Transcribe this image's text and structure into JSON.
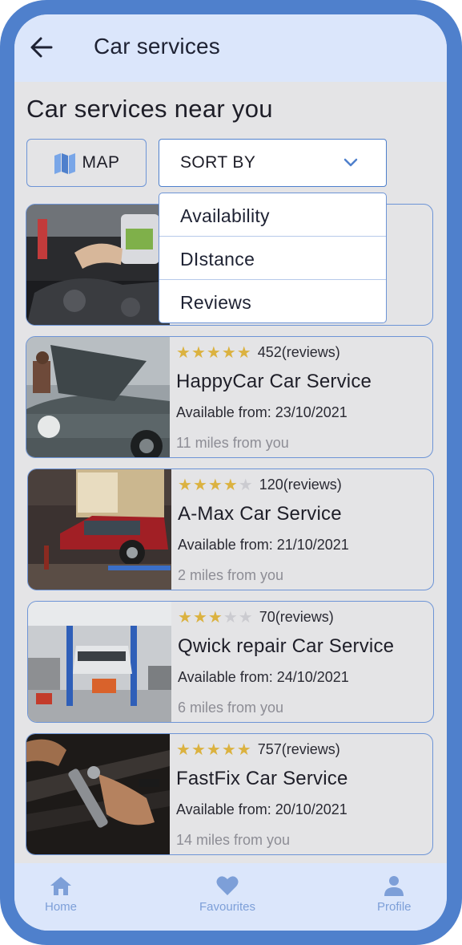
{
  "header": {
    "title": "Car services",
    "back_icon": "arrow-left-icon"
  },
  "section_title": "Car services near you",
  "controls": {
    "map_label": "MAP",
    "map_icon": "map-icon",
    "sort_label": "SORT BY",
    "sort_icon": "chevron-down-icon",
    "sort_options": [
      "Availability",
      "DIstance",
      "Reviews"
    ]
  },
  "cards": [
    {
      "rating": 5,
      "reviews": "452(reviews)",
      "name": "HappyCar Car Service",
      "available": "Available from: 23/10/2021",
      "distance": "11 miles from you"
    },
    {
      "rating": 4,
      "reviews": "120(reviews)",
      "name": "A-Max Car Service",
      "available": "Available from: 21/10/2021",
      "distance": "2 miles from you"
    },
    {
      "rating": 3,
      "reviews": "70(reviews)",
      "name": "Qwick repair Car Service",
      "available": "Available from: 24/10/2021",
      "distance": "6 miles from you"
    },
    {
      "rating": 5,
      "reviews": "757(reviews)",
      "name": "FastFix Car Service",
      "available": "Available from: 20/10/2021",
      "distance": "14 miles from you"
    }
  ],
  "nav": {
    "home": {
      "label": "Home",
      "icon": "home-icon"
    },
    "favourites": {
      "label": "Favourites",
      "icon": "heart-icon"
    },
    "profile": {
      "label": "Profile",
      "icon": "user-icon"
    }
  },
  "colors": {
    "frame": "#4f80cc",
    "header_bg": "#dbe6fb",
    "screen_bg": "#e4e4e6",
    "accent": "#4f80cc",
    "star": "#dbb240",
    "star_off": "#cbcbd0",
    "nav_label": "#7d9fd8"
  }
}
